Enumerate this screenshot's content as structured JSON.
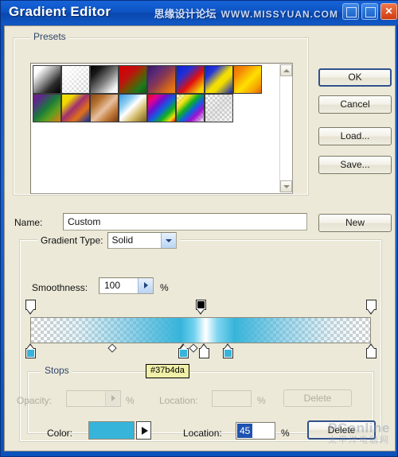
{
  "window": {
    "title": "Gradient Editor",
    "titlebar_watermark_cn": "思缘设计论坛",
    "titlebar_watermark_url": "WWW.MISSYUAN.COM",
    "minimize_icon": "minimize-icon",
    "maximize_icon": "maximize-icon",
    "close_icon": "close-icon",
    "close_glyph": "✕"
  },
  "presets": {
    "title": "Presets",
    "menu_icon": "preset-menu-arrow-icon",
    "scroll_up_icon": "scroll-up-arrow-icon",
    "scroll_down_icon": "scroll-down-arrow-icon",
    "swatches": [
      {
        "name": "foreground-to-background",
        "css": "linear-gradient(135deg,#ffffff 0%,#ffffff 18%,#9b9b9b 45%,#2a2a2a 72%,#000000 100%)"
      },
      {
        "name": "foreground-to-transparent",
        "css": "linear-gradient(135deg,#ffffff 0%,rgba(255,255,255,0) 100%)"
      },
      {
        "name": "black-white",
        "css": "linear-gradient(135deg,#000000 0%,#1a1a1a 22%,#808080 55%,#f2f2f2 85%,#ffffff 100%)"
      },
      {
        "name": "red-green",
        "css": "linear-gradient(135deg,#d40000 0%,#c01010 35%,#7a4a00 55%,#1c7a1c 80%,#0a5a0a 100%)"
      },
      {
        "name": "violet-orange",
        "css": "linear-gradient(135deg,#3a1760 0%,#5a2a78 25%,#8c3a50 50%,#d4661a 78%,#f08a12 100%)"
      },
      {
        "name": "blue-red-yellow",
        "css": "linear-gradient(135deg,#1020c8 0%,#2030d8 28%,#e01010 58%,#f5d000 88%,#ffd400 100%)"
      },
      {
        "name": "blue-yellow-blue",
        "css": "linear-gradient(135deg,#1020c8 0%,#2838d8 24%,#f5e000 52%,#f0dc00 64%,#1020c0 100%)"
      },
      {
        "name": "orange-yellow-orange",
        "css": "linear-gradient(135deg,#f07000 0%,#f58a08 22%,#ffe000 55%,#f5a000 82%,#e06000 100%)"
      },
      {
        "name": "violet-green-orange",
        "css": "linear-gradient(135deg,#7a1a8a 0%,#5a2a8a 18%,#1a7a3a 48%,#5aa020 70%,#e07a10 100%)"
      },
      {
        "name": "yellow-violet-orange-blue",
        "css": "linear-gradient(135deg,#f5e000 0%,#f0d800 22%,#a03070 46%,#e07018 70%,#10309c 100%)"
      },
      {
        "name": "copper",
        "css": "linear-gradient(135deg,#8a4a18 0%,#b4702e 25%,#e8c0a0 52%,#c07a3a 74%,#7a3a10 100%)"
      },
      {
        "name": "chrome",
        "css": "linear-gradient(135deg,#3a9ae0 0%,#8fd0f2 28%,#ffffff 46%,#d8c070 68%,#7a5e18 100%)"
      },
      {
        "name": "spectrum",
        "css": "linear-gradient(135deg,#e01010 0%,#e8008c 18%,#6a10d0 36%,#1060e0 54%,#10b020 72%,#f0e010 88%,#e01010 100%)"
      },
      {
        "name": "transparent-rainbow",
        "css": "linear-gradient(135deg,rgba(255,255,255,0) 0%,#f0e010 26%,#10b020 42%,#1060e0 58%,#a010d0 74%,rgba(255,255,255,0) 100%)"
      },
      {
        "name": "transparent-stripes",
        "css": "linear-gradient(135deg,rgba(255,255,255,0) 0%,rgba(200,200,200,.45) 50%,rgba(255,255,255,0) 100%)"
      }
    ]
  },
  "buttons": {
    "ok": "OK",
    "cancel": "Cancel",
    "load": "Load...",
    "save": "Save...",
    "new": "New"
  },
  "name_row": {
    "label": "Name:",
    "value": "Custom"
  },
  "gradient_type": {
    "label": "Gradient Type:",
    "value": "Solid",
    "dropdown_icon": "chevron-down-icon"
  },
  "smoothness": {
    "label": "Smoothness:",
    "value": "100",
    "percent": "%",
    "stepper_icon": "chevron-right-icon"
  },
  "gradient_bar": {
    "css": "linear-gradient(to right, rgba(255,255,255,0) 0%, rgba(160,215,235,0.30) 14%, rgba(90,190,225,0.62) 28%, #37b4da 44%, #6fd0ee 48%, #ffffff 51.5%, #7fd6f0 55%, #37b4da 60%, rgba(90,190,225,0.62) 74%, rgba(160,215,235,0.30) 88%, rgba(255,255,255,0) 100%)",
    "opacity_stops": [
      {
        "name": "opacity-stop-left",
        "pos_pct": 0,
        "opacity": 0,
        "fill": "#ffffff",
        "selected": false
      },
      {
        "name": "opacity-stop-middle",
        "pos_pct": 50,
        "opacity": 100,
        "fill": "#000000",
        "selected": true
      },
      {
        "name": "opacity-stop-right",
        "pos_pct": 100,
        "opacity": 0,
        "fill": "#ffffff",
        "selected": false
      }
    ],
    "color_stops": [
      {
        "name": "color-stop-left",
        "pos_pct": 0,
        "color": "#37b4da",
        "selected": false
      },
      {
        "name": "color-stop-selected",
        "pos_pct": 45,
        "color": "#37b4da",
        "selected": true
      },
      {
        "name": "color-stop-white",
        "pos_pct": 51,
        "color": "#ffffff",
        "selected": false
      },
      {
        "name": "color-stop-right-blue",
        "pos_pct": 58,
        "color": "#37b4da",
        "selected": false
      },
      {
        "name": "color-stop-end",
        "pos_pct": 100,
        "color": "#ffffff",
        "selected": false
      }
    ],
    "midpoints": [
      {
        "name": "midpoint-opacity-left",
        "pos_pct": 24
      },
      {
        "name": "midpoint-color-white",
        "pos_pct": 48
      }
    ]
  },
  "tooltip": {
    "text": "#37b4da"
  },
  "stops": {
    "title": "Stops",
    "opacity_label": "Opacity:",
    "opacity_value": "",
    "opacity_percent": "%",
    "opacity_location_label": "Location:",
    "opacity_location_value": "",
    "opacity_location_percent": "%",
    "opacity_delete": "Delete",
    "color_label": "Color:",
    "color_value": "#37b4da",
    "color_arrow_icon": "color-dropdown-arrow-icon",
    "color_location_label": "Location:",
    "color_location_value": "45",
    "color_location_percent": "%",
    "color_delete": "Delete"
  },
  "footer_watermark": {
    "line1": "PConline",
    "line2": "太平洋电脑网"
  },
  "colors": {
    "accent": "#37b4da",
    "titlebar": "#1464d6",
    "dialog_face": "#ece9d8",
    "selection": "#1f52b0",
    "tooltip_bg": "#f0f0a8"
  }
}
